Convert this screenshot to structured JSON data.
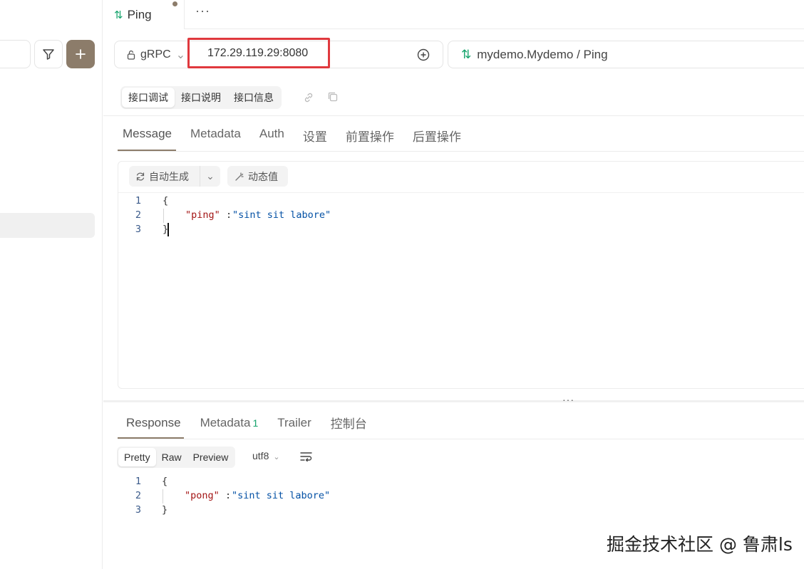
{
  "tabbar": {
    "active_tab_label": "Ping",
    "more_label": "···"
  },
  "request": {
    "method": "gRPC",
    "url": "172.29.119.29:8080",
    "service_path": "mydemo.Mydemo / Ping"
  },
  "segment": {
    "items": [
      "接口调试",
      "接口说明",
      "接口信息"
    ]
  },
  "request_tabs": [
    "Message",
    "Metadata",
    "Auth",
    "设置",
    "前置操作",
    "后置操作"
  ],
  "toolbar": {
    "auto_generate_label": "自动生成",
    "dynamic_value_label": "动态值"
  },
  "request_body": {
    "line_numbers": [
      "1",
      "2",
      "3"
    ],
    "open_brace": "{",
    "key": "\"ping\"",
    "colon": ": ",
    "value": "\"sint sit labore\"",
    "close_brace": "}"
  },
  "response_tabs": {
    "items": [
      "Response",
      "Metadata",
      "Trailer",
      "控制台"
    ],
    "metadata_count": "1"
  },
  "response_format": {
    "options": [
      "Pretty",
      "Raw",
      "Preview"
    ],
    "encoding": "utf8"
  },
  "response_body": {
    "line_numbers": [
      "1",
      "2",
      "3"
    ],
    "open_brace": "{",
    "key": "\"pong\"",
    "colon": ": ",
    "value": "\"sint sit labore\"",
    "close_brace": "}"
  },
  "watermark": "掘金技术社区 @ 鲁肃ls",
  "colors": {
    "accent": "#8c7c6a",
    "green": "#14a36b",
    "highlight_red": "#e0393e",
    "json_key": "#a31515",
    "json_string": "#0451a5"
  }
}
